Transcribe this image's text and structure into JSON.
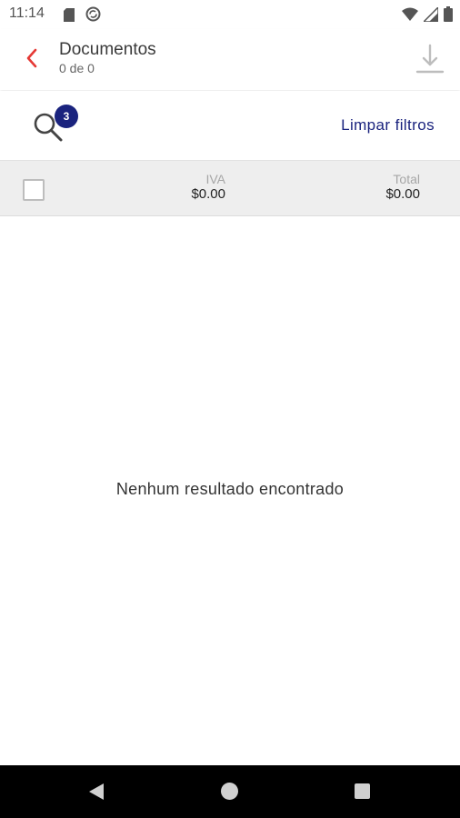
{
  "status_bar": {
    "time": "11:14",
    "icons": [
      "sd-card-icon",
      "sync-icon",
      "wifi-icon",
      "signal-icon",
      "battery-icon"
    ]
  },
  "header": {
    "title": "Documentos",
    "subtitle": "0 de 0",
    "back_icon": "chevron-left-icon",
    "download_icon": "download-icon",
    "accent_color": "#e53935"
  },
  "filters": {
    "search_icon": "search-icon",
    "badge_count": "3",
    "clear_label": "Limpar filtros",
    "brand_color": "#1a237e"
  },
  "summary": {
    "iva_label": "IVA",
    "iva_value": "$0.00",
    "total_label": "Total",
    "total_value": "$0.00"
  },
  "empty_state": {
    "message": "Nenhum resultado encontrado"
  },
  "nav_bar": {
    "icons": [
      "back-triangle-icon",
      "home-circle-icon",
      "recents-square-icon"
    ]
  }
}
